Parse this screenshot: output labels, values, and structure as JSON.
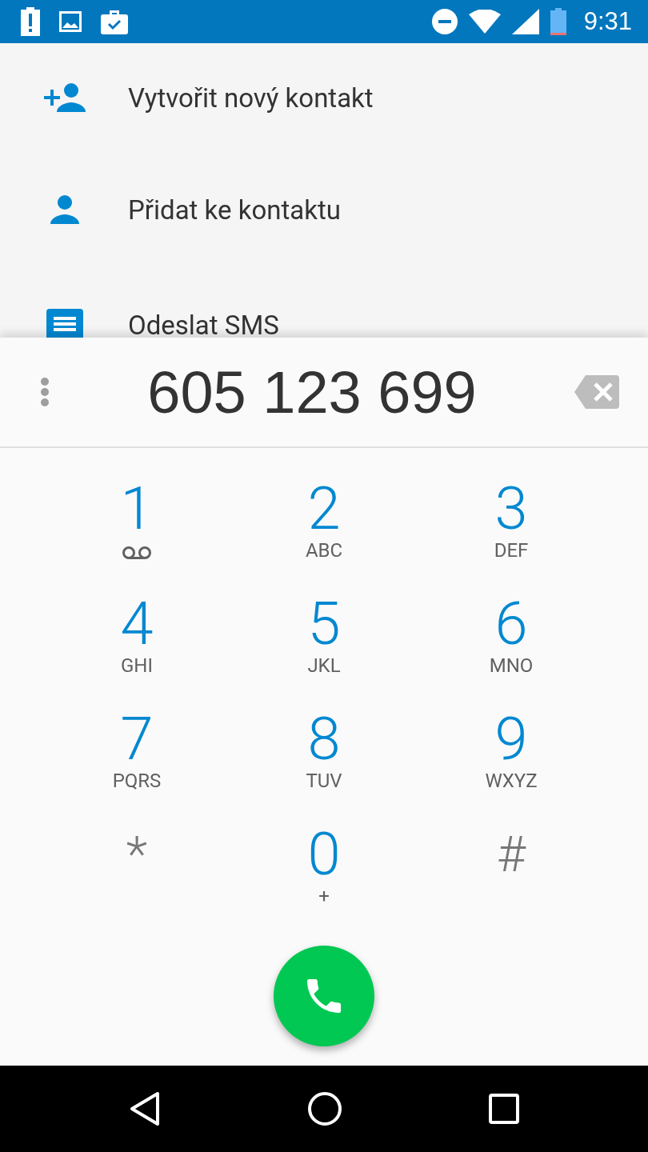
{
  "status_bar": {
    "time": "9:31"
  },
  "actions": [
    {
      "kind": "add_person",
      "label": "Vytvořit nový kontakt"
    },
    {
      "kind": "person",
      "label": "Přidat ke kontaktu"
    },
    {
      "kind": "message",
      "label": "Odeslat SMS"
    }
  ],
  "dialpad": {
    "number": "605 123 699",
    "keys": [
      {
        "kind": "voicemail",
        "main": "1"
      },
      {
        "kind": "digit",
        "main": "2",
        "sub": "ABC"
      },
      {
        "kind": "digit",
        "main": "3",
        "sub": "DEF"
      },
      {
        "kind": "digit",
        "main": "4",
        "sub": "GHI"
      },
      {
        "kind": "digit",
        "main": "5",
        "sub": "JKL"
      },
      {
        "kind": "digit",
        "main": "6",
        "sub": "MNO"
      },
      {
        "kind": "digit",
        "main": "7",
        "sub": "PQRS"
      },
      {
        "kind": "digit",
        "main": "8",
        "sub": "TUV"
      },
      {
        "kind": "digit",
        "main": "9",
        "sub": "WXYZ"
      },
      {
        "kind": "symbol",
        "main": "*"
      },
      {
        "kind": "digit",
        "main": "0",
        "sub": "+"
      },
      {
        "kind": "symbol",
        "main": "#"
      }
    ]
  }
}
